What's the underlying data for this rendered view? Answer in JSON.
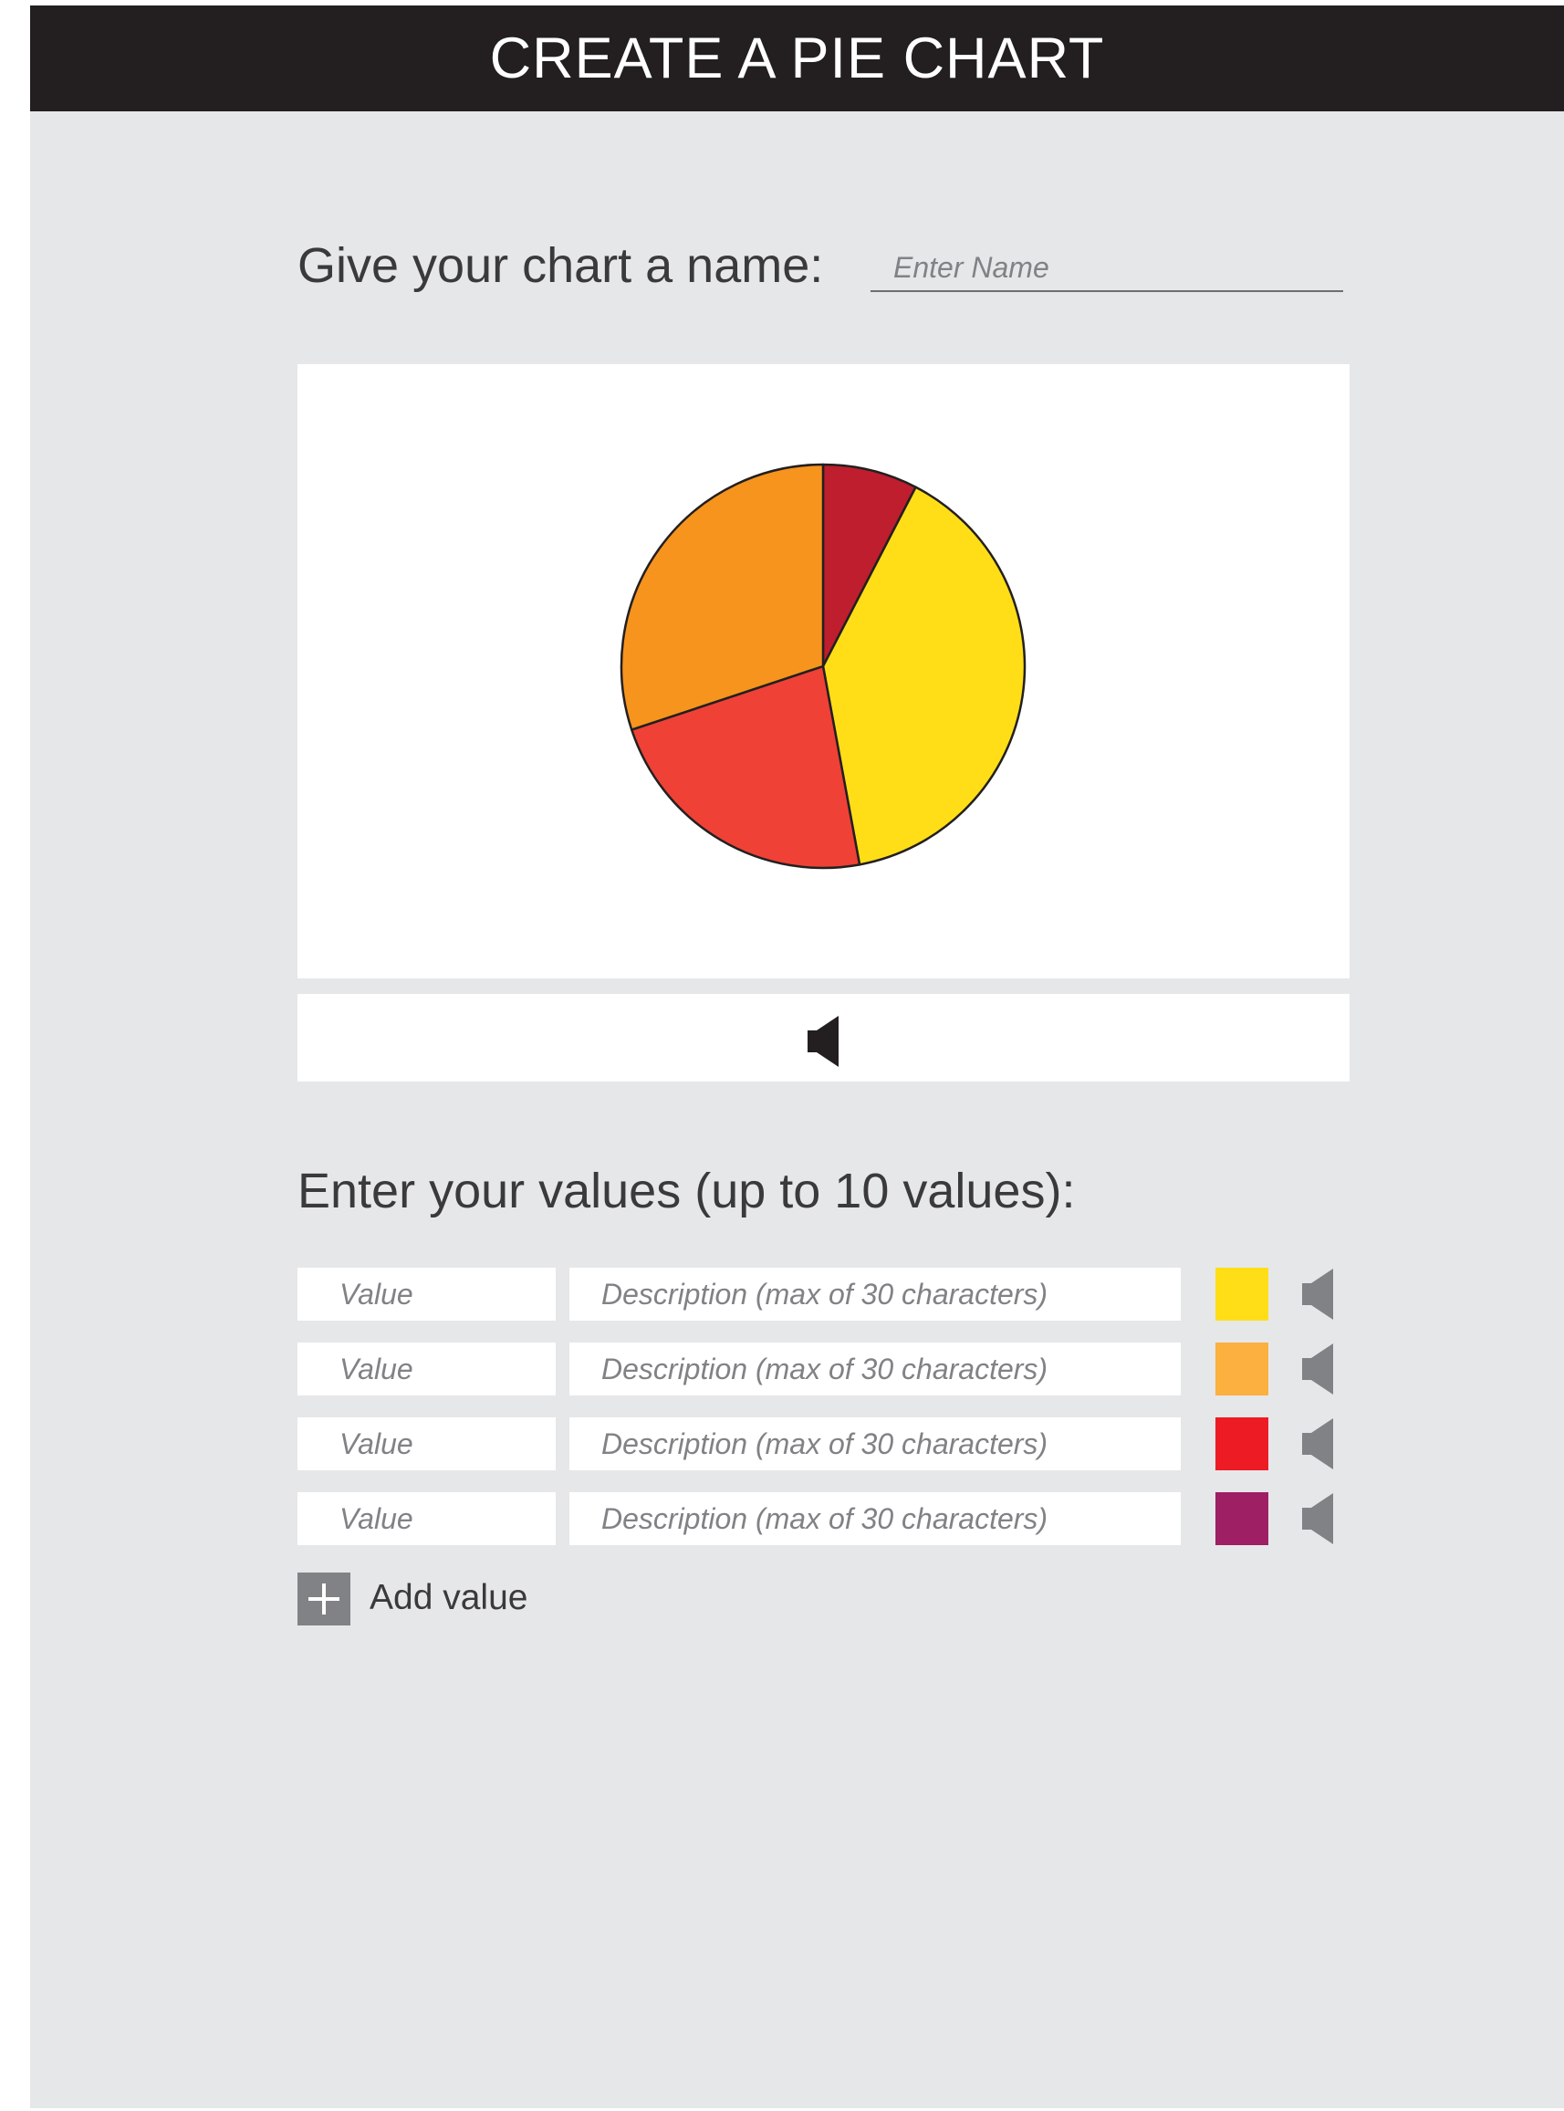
{
  "header": {
    "title": "CREATE A PIE CHART"
  },
  "name_field": {
    "label": "Give your chart a name:",
    "placeholder": "Enter Name",
    "value": ""
  },
  "chart_data": {
    "type": "pie",
    "title": "",
    "slices": [
      {
        "color": "#be1e2d",
        "fraction": 0.076
      },
      {
        "color": "#ffde17",
        "fraction": 0.395
      },
      {
        "color": "#ef4136",
        "fraction": 0.228
      },
      {
        "color": "#f7941d",
        "fraction": 0.301
      }
    ],
    "start_angle_deg": -90,
    "outline_color": "#231f20"
  },
  "audio_bar": {
    "icon": "speaker-icon",
    "color": "#231f20"
  },
  "values_section": {
    "heading": "Enter your values (up to 10 values):",
    "rows": [
      {
        "value_placeholder": "Value",
        "description_placeholder": "Description (max of 30 characters)",
        "color": "#ffde17",
        "icon": "speaker-icon"
      },
      {
        "value_placeholder": "Value",
        "description_placeholder": "Description (max of 30 characters)",
        "color": "#fbb040",
        "icon": "speaker-icon"
      },
      {
        "value_placeholder": "Value",
        "description_placeholder": "Description (max of 30 characters)",
        "color": "#ed1c24",
        "icon": "speaker-icon"
      },
      {
        "value_placeholder": "Value",
        "description_placeholder": "Description (max of 30 characters)",
        "color": "#9e1f63",
        "icon": "speaker-icon"
      }
    ],
    "speaker_color": "#808285"
  },
  "add_value": {
    "label": "Add value",
    "icon": "plus-icon"
  }
}
